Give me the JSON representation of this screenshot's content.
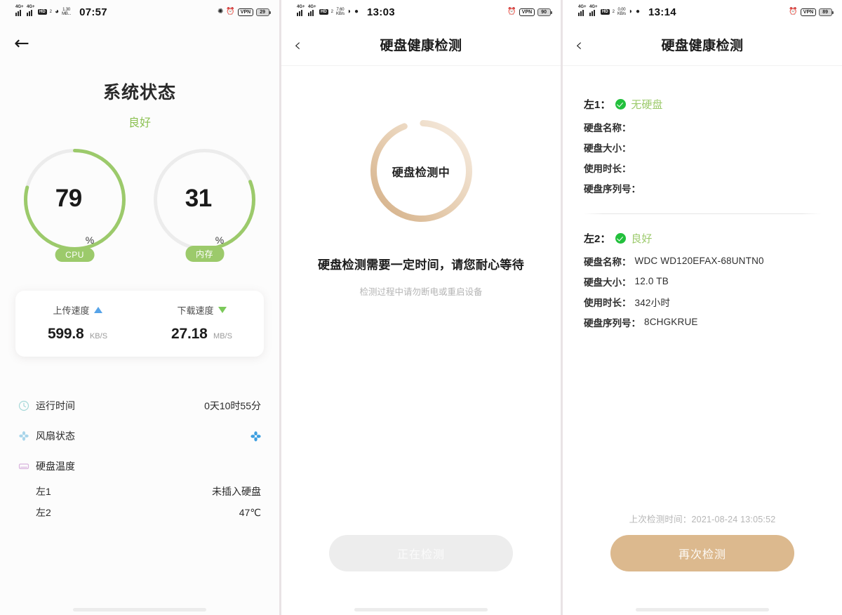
{
  "panel1": {
    "statusbar": {
      "net1": "4G+",
      "net2": "4G+",
      "hd": "HD",
      "hd_sub": "1",
      "hd_sub2": "2",
      "wifi": "wifi-icon",
      "rate_value": "1.30",
      "rate_unit": "MB...",
      "clock": "07:57",
      "bluetooth": "8",
      "alarm": "alarm-icon",
      "vpn": "VPN",
      "battery": "29"
    },
    "back_icon": "←",
    "title": "系统状态",
    "subtitle": "良好",
    "gauges": [
      {
        "name": "cpu",
        "value": 79,
        "unit": "%",
        "chip": "CPU"
      },
      {
        "name": "memory",
        "value": 31,
        "unit": "%",
        "chip": "内存"
      }
    ],
    "speed": {
      "upload": {
        "label": "上传速度",
        "value": "599.8",
        "unit": "KB/S",
        "arrow": "arrow-up-icon",
        "color": "#56a3e8"
      },
      "download": {
        "label": "下载速度",
        "value": "27.18",
        "unit": "MB/S",
        "arrow": "arrow-down-icon",
        "color": "#7bc95a"
      }
    },
    "info": {
      "uptime_label": "运行时间",
      "uptime_value": "0天10时55分",
      "fan_label": "风扇状态",
      "disk_temp_label": "硬盘温度",
      "bay1_label": "左1",
      "bay1_value": "未插入硬盘",
      "bay2_label": "左2",
      "bay2_value": "47℃"
    }
  },
  "panel2": {
    "statusbar": {
      "net1": "4G+",
      "net2": "4G+",
      "hd": "HD",
      "hd_sub": "1",
      "hd_sub2": "2",
      "rate_value": "7.60",
      "rate_unit": "KB/s",
      "clock": "13:03",
      "vpn": "VPN",
      "battery": "90"
    },
    "back_icon": "‹",
    "title": "硬盘健康检测",
    "spinner_label": "硬盘检测中",
    "scan_main": "硬盘检测需要一定时间，请您耐心等待",
    "scan_sub": "检测过程中请勿断电或重启设备",
    "button_label": "正在检测",
    "spinner_color": "#d8b894"
  },
  "panel3": {
    "statusbar": {
      "net1": "4G+",
      "net2": "4G+",
      "hd": "HD",
      "hd_sub": "1",
      "hd_sub2": "2",
      "rate_value": "0.00",
      "rate_unit": "KB/s",
      "clock": "13:14",
      "vpn": "VPN",
      "battery": "89"
    },
    "back_icon": "‹",
    "title": "硬盘健康检测",
    "disks": [
      {
        "bay": "左1：",
        "status": "无硬盘",
        "rows": [
          {
            "k": "硬盘名称：",
            "v": ""
          },
          {
            "k": "硬盘大小：",
            "v": ""
          },
          {
            "k": "使用时长：",
            "v": ""
          },
          {
            "k": "硬盘序列号：",
            "v": ""
          }
        ]
      },
      {
        "bay": "左2：",
        "status": "良好",
        "rows": [
          {
            "k": "硬盘名称：",
            "v": "WDC WD120EFAX-68UNTN0"
          },
          {
            "k": "硬盘大小：",
            "v": "12.0 TB"
          },
          {
            "k": "使用时长：",
            "v": "342小时"
          },
          {
            "k": "硬盘序列号：",
            "v": "8CHGKRUE"
          }
        ]
      }
    ],
    "last_scan": "上次检测时间：2021-08-24 13:05:52",
    "button_label": "再次检测"
  },
  "theme": {
    "green": "#9cca6b",
    "track": "#ececec",
    "tan": "#dcb98e",
    "check_green": "#22c03c",
    "blue": "#56a3e8"
  }
}
